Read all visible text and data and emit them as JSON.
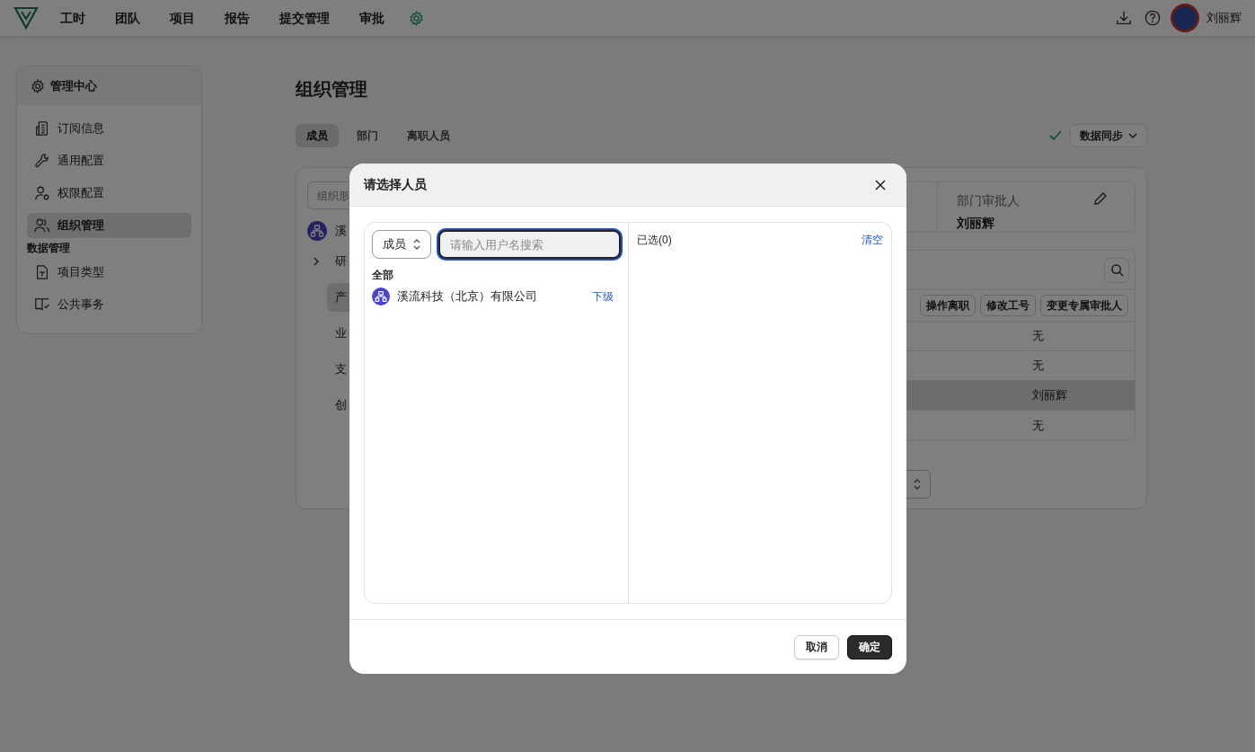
{
  "nav": {
    "items": [
      {
        "label": "工时"
      },
      {
        "label": "团队"
      },
      {
        "label": "项目"
      },
      {
        "label": "报告"
      },
      {
        "label": "提交管理"
      },
      {
        "label": "审批"
      }
    ],
    "user": {
      "name": "刘丽辉"
    }
  },
  "sidebar": {
    "title": "管理中心",
    "items": [
      {
        "label": "订阅信息",
        "selected": false
      },
      {
        "label": "通用配置",
        "selected": false
      },
      {
        "label": "权限配置",
        "selected": false
      },
      {
        "label": "组织管理",
        "selected": true
      }
    ],
    "section": {
      "title": "数据管理",
      "items": [
        {
          "label": "项目类型",
          "selected": false
        },
        {
          "label": "公共事务",
          "selected": false
        }
      ]
    }
  },
  "page": {
    "title": "组织管理",
    "tabs": [
      {
        "label": "成员",
        "selected": true
      },
      {
        "label": "部门",
        "selected": false
      },
      {
        "label": "离职人员",
        "selected": false
      }
    ],
    "sync": {
      "label": "数据同步"
    }
  },
  "org_panel": {
    "search": {
      "placeholder": "组织形"
    },
    "tree": [
      {
        "label": "溪",
        "children": [
          {
            "label": "研",
            "expandable": true,
            "selected": false
          },
          {
            "label": "产",
            "expandable": false,
            "selected": true
          },
          {
            "label": "业",
            "expandable": false,
            "selected": false
          },
          {
            "label": "支",
            "expandable": false,
            "selected": false
          },
          {
            "label": "创",
            "expandable": false,
            "selected": false
          }
        ]
      }
    ]
  },
  "approver": {
    "label": "部门审批人",
    "value": "刘丽辉"
  },
  "member_actions": [
    "操作离职",
    "修改工号",
    "变更专属审批人"
  ],
  "table": {
    "rows": [
      {
        "value": "无",
        "selected": false
      },
      {
        "value": "无",
        "selected": false
      },
      {
        "value": "刘丽辉",
        "selected": true
      },
      {
        "value": "无",
        "selected": false
      }
    ]
  },
  "modal": {
    "title": "请选择人员",
    "filter": {
      "value": "成员"
    },
    "search": {
      "placeholder": "请输入用户名搜索"
    },
    "group_label": "全部",
    "items": [
      {
        "name": "溪流科技（北京）有限公司",
        "action": "下级"
      }
    ],
    "selected_label": "已选(0)",
    "clear": "清空",
    "buttons": [
      {
        "label": "取消",
        "kind": "secondary"
      },
      {
        "label": "确定",
        "kind": "primary"
      }
    ]
  }
}
